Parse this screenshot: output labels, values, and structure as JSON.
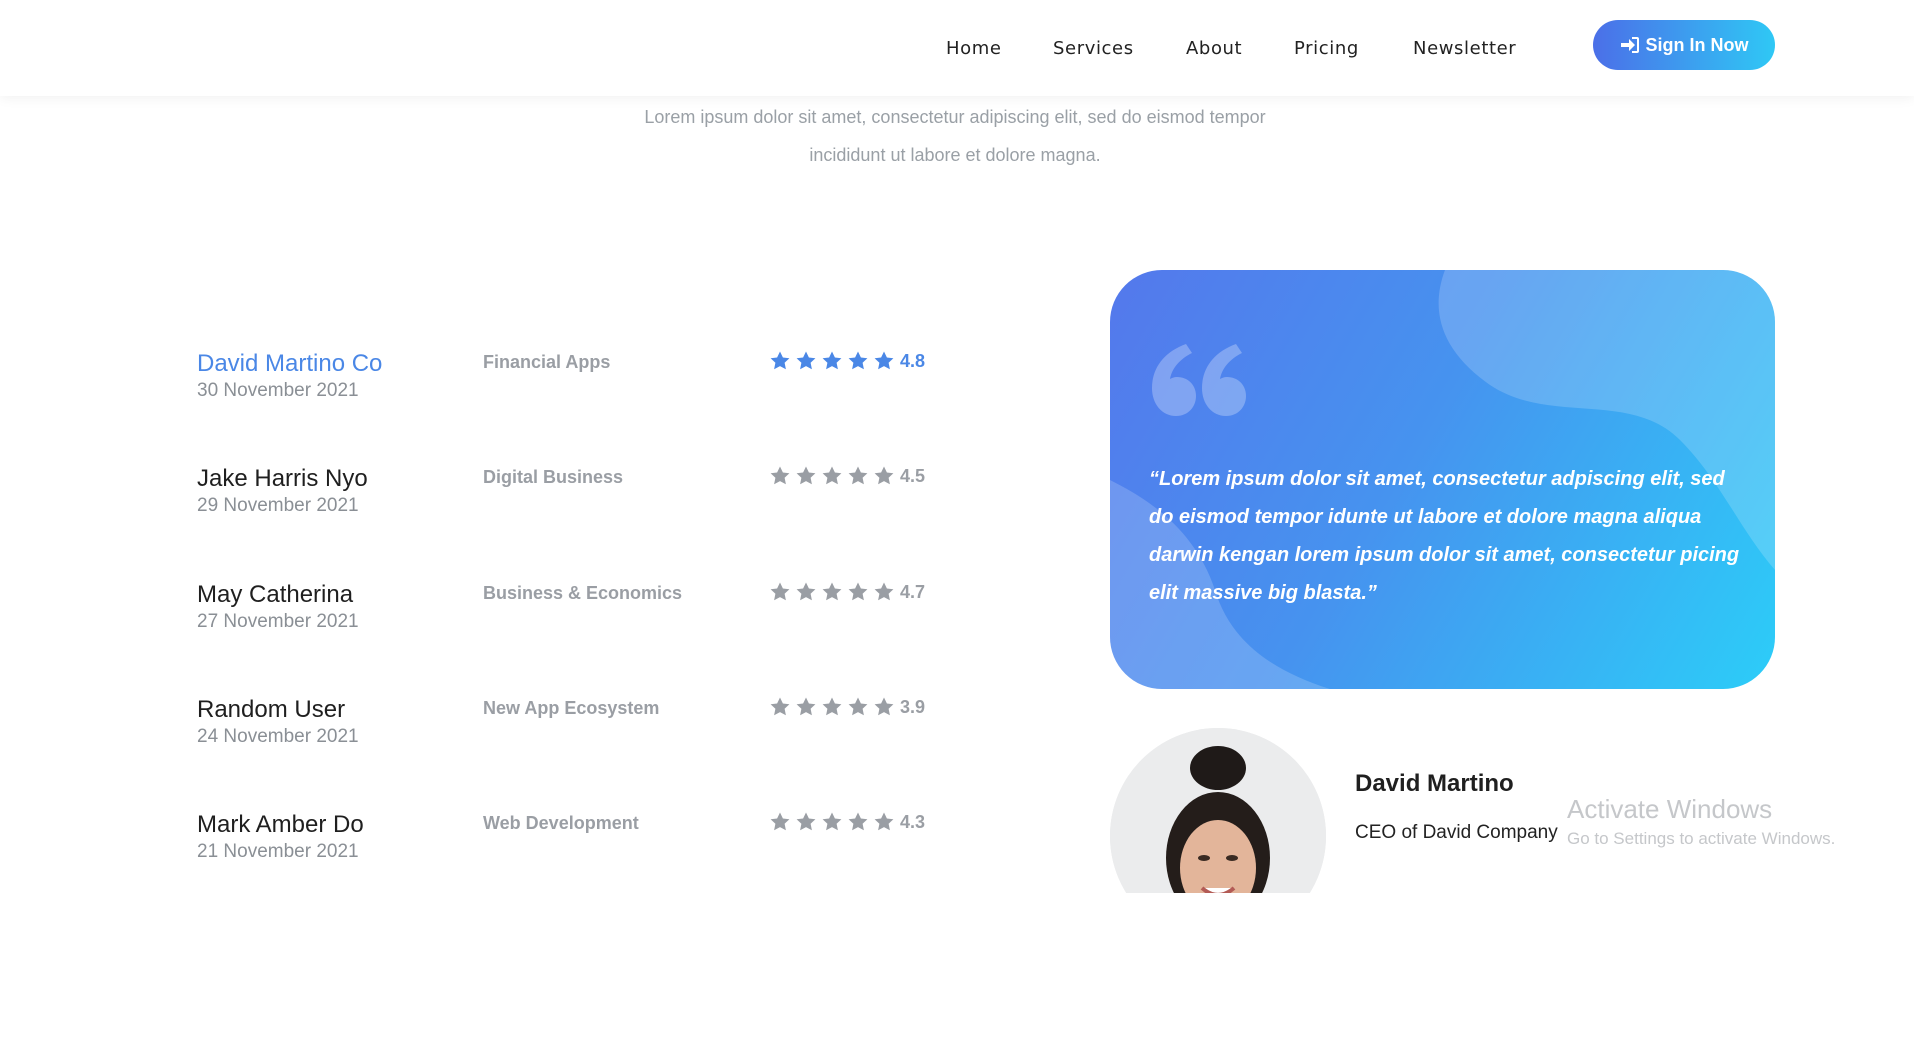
{
  "nav": {
    "items": [
      "Home",
      "Services",
      "About",
      "Pricing",
      "Newsletter"
    ],
    "signin_label": "Sign In Now"
  },
  "intro": {
    "line1": "Lorem ipsum dolor sit amet, consectetur adipiscing elit, sed do eismod tempor",
    "line2": "incididunt ut labore et dolore magna."
  },
  "reviews": [
    {
      "name": "David Martino Co",
      "date": "30 November 2021",
      "category": "Financial Apps",
      "rating": "4.8",
      "stars": 5,
      "active": true
    },
    {
      "name": "Jake Harris Nyo",
      "date": "29 November 2021",
      "category": "Digital Business",
      "rating": "4.5",
      "stars": 5,
      "active": false
    },
    {
      "name": "May Catherina",
      "date": "27 November 2021",
      "category": "Business & Economics",
      "rating": "4.7",
      "stars": 5,
      "active": false
    },
    {
      "name": "Random User",
      "date": "24 November 2021",
      "category": "New App Ecosystem",
      "rating": "3.9",
      "stars": 5,
      "active": false
    },
    {
      "name": "Mark Amber Do",
      "date": "21 November 2021",
      "category": "Web Development",
      "rating": "4.3",
      "stars": 5,
      "active": false
    }
  ],
  "quote": {
    "text": "“Lorem ipsum dolor sit amet, consectetur adpiscing elit, sed do eismod tempor idunte ut labore et dolore magna aliqua darwin kengan lorem ipsum dolor sit amet, consectetur picing elit massive big blasta.”"
  },
  "author": {
    "name": "David Martino",
    "role": "CEO of David Company"
  },
  "watermark": {
    "title": "Activate Windows",
    "subtitle": "Go to Settings to activate Windows."
  },
  "colors": {
    "accent": "#4a87e6",
    "gradient_start": "#4b6fe8",
    "gradient_end": "#2fc8f5",
    "muted": "#9a9ea4"
  },
  "icons": {
    "signin": "sign-in-icon",
    "star": "star-icon",
    "quote": "quote-icon"
  }
}
